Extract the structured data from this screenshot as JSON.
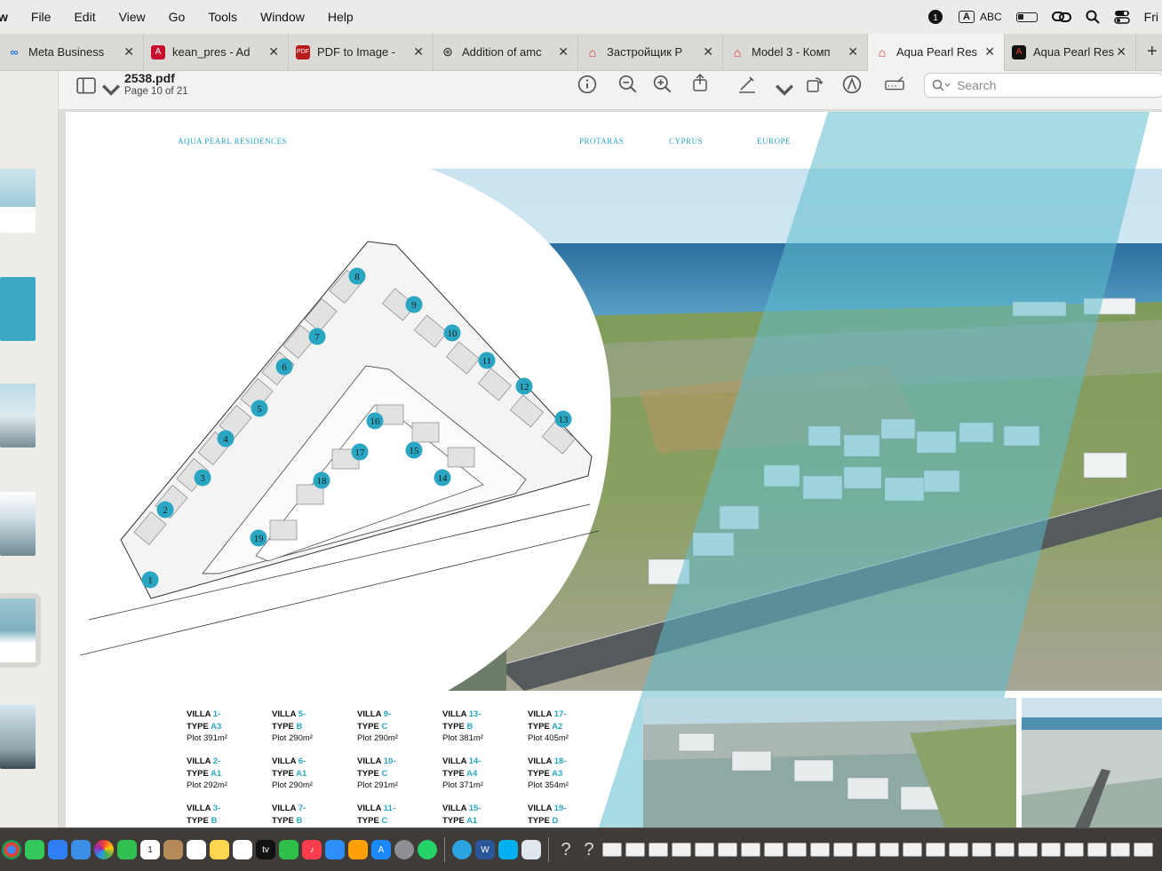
{
  "menubar": {
    "app_partial": "w",
    "items": [
      "File",
      "Edit",
      "View",
      "Go",
      "Tools",
      "Window",
      "Help"
    ],
    "status": {
      "input_source": "ABC",
      "keyboard_badge": "A",
      "clock": "Fri"
    }
  },
  "tabs": [
    {
      "label": "Meta Business",
      "icon": "meta-icon",
      "color": "#1877f2"
    },
    {
      "label": "kean_pres - Ad",
      "icon": "acrobat-icon",
      "color": "#c8102e"
    },
    {
      "label": "PDF to Image -",
      "icon": "pdf-icon",
      "color": "#b71c1c"
    },
    {
      "label": "Addition of amc",
      "icon": "openai-icon",
      "color": "#222222"
    },
    {
      "label": "Застройщик Р",
      "icon": "house-icon",
      "color": "#d32f2f"
    },
    {
      "label": "Model 3 - Комп",
      "icon": "house-icon",
      "color": "#d32f2f"
    },
    {
      "label": "Aqua Pearl Res",
      "icon": "house-icon",
      "color": "#d32f2f",
      "active": true
    },
    {
      "label": "Aqua Pearl Res",
      "icon": "pdf-app-icon",
      "color": "#b71c1c"
    }
  ],
  "toolbar": {
    "doc_title": "2538.pdf",
    "page_info": "Page 10 of 21",
    "search_placeholder": "Search"
  },
  "page": {
    "brand": "AQUA PEARL RESIDENCES",
    "nav": [
      "PROTARAS",
      "CYPRUS",
      "EUROPE"
    ],
    "plan_numbers": [
      "1",
      "2",
      "3",
      "4",
      "5",
      "6",
      "7",
      "8",
      "9",
      "10",
      "11",
      "12",
      "13",
      "14",
      "15",
      "16",
      "17",
      "18",
      "19"
    ],
    "villas": [
      {
        "num": "1",
        "type": "A3",
        "plot": "Plot  391m²"
      },
      {
        "num": "2",
        "type": "A1",
        "plot": "Plot 292m²"
      },
      {
        "num": "3",
        "type": "B",
        "plot": ""
      },
      {
        "num": "5",
        "type": "B",
        "plot": "Plot 290m²"
      },
      {
        "num": "6",
        "type": "A1",
        "plot": "Plot 290m²"
      },
      {
        "num": "7",
        "type": "B",
        "plot": ""
      },
      {
        "num": "9",
        "type": "C",
        "plot": "Plot 290m²"
      },
      {
        "num": "10",
        "type": "C",
        "plot": "Plot 291m²"
      },
      {
        "num": "11",
        "type": "C",
        "plot": ""
      },
      {
        "num": "13",
        "type": "B",
        "plot": "Plot 381m²"
      },
      {
        "num": "14",
        "type": "A4",
        "plot": "Plot 371m²"
      },
      {
        "num": "15",
        "type": "A1",
        "plot": ""
      },
      {
        "num": "17",
        "type": "A2",
        "plot": "Plot 405m²"
      },
      {
        "num": "18",
        "type": "A3",
        "plot": "Plot 354m²"
      },
      {
        "num": "19",
        "type": "D",
        "plot": ""
      }
    ],
    "villa_word": "VILLA",
    "type_word": "TYPE"
  },
  "colors": {
    "accent": "#2aa6c2",
    "teal_band": "#5fbccc"
  }
}
